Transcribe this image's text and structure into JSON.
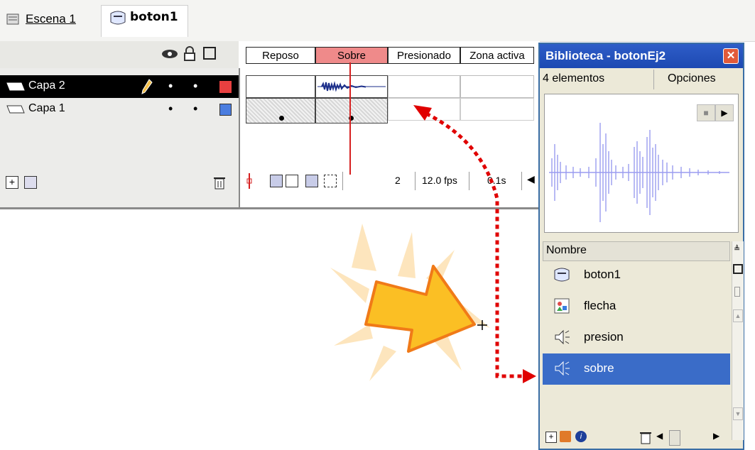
{
  "breadcrumb": {
    "scene": "Escena 1",
    "symbol": "boton1"
  },
  "timeline": {
    "frame_headers": [
      "Reposo",
      "Sobre",
      "Presionado",
      "Zona activa"
    ],
    "layers": [
      {
        "name": "Capa 2",
        "color": "#e84040"
      },
      {
        "name": "Capa 1",
        "color": "#4a7de0"
      }
    ],
    "status": {
      "frame": "2",
      "fps": "12.0 fps",
      "time": "0.1s"
    }
  },
  "library": {
    "title": "Biblioteca - botonEj2",
    "count": "4 elementos",
    "options": "Opciones",
    "column": "Nombre",
    "items": [
      {
        "name": "boton1",
        "icon": "button-symbol-icon"
      },
      {
        "name": "flecha",
        "icon": "graphic-symbol-icon"
      },
      {
        "name": "presion",
        "icon": "sound-icon"
      },
      {
        "name": "sobre",
        "icon": "sound-icon"
      }
    ],
    "selected": "sobre"
  },
  "colors": {
    "selection": "#3a6cc8",
    "sobre_frame": "#ef8a8a",
    "arrow": "#fbbf24",
    "annotation": "#e00000"
  }
}
